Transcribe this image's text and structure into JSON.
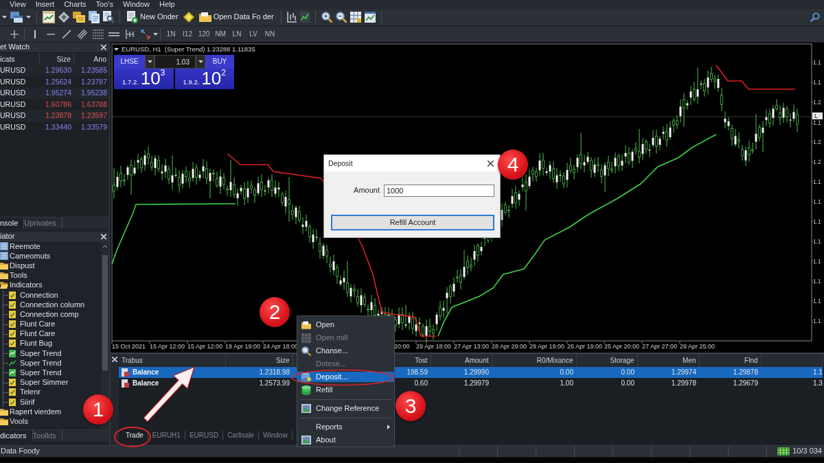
{
  "menu_bar": [
    "View",
    "Insert",
    "Charts",
    "Too's",
    "Window",
    "Help"
  ],
  "toolbar": {
    "new_order": "New Onder",
    "open_data_folder": "Open Data Fo der"
  },
  "timeframes": [
    "1N",
    "I12",
    "120",
    "NM",
    "LN",
    "LV",
    "NN"
  ],
  "market_watch": {
    "title": "et Watch",
    "columns": [
      "icats",
      "Size",
      "Ano"
    ],
    "rows": [
      {
        "symbol": "URUSD",
        "bid": "1.29630",
        "ask": "1.23585",
        "color": "#8585f0"
      },
      {
        "symbol": "URUSD",
        "bid": "1.25624",
        "ask": "1.23787",
        "color": "#8585f0"
      },
      {
        "symbol": "URUSD",
        "bid": "1.95274",
        "ask": "1.95238",
        "color": "#8585f0"
      },
      {
        "symbol": "URUSD",
        "bid": "1.60786",
        "ask": "1.63788",
        "color": "#e0524c"
      },
      {
        "symbol": "URUSD",
        "bid": "1.23878",
        "ask": "1.23597",
        "color": "#e0524c"
      },
      {
        "symbol": "URUSD",
        "bid": "1.33440",
        "ask": "1.33579",
        "color": "#8585f0"
      }
    ]
  },
  "left_tabs": [
    {
      "label": "nsole",
      "selected": true
    },
    {
      "label": "Uprivates",
      "selected": false
    }
  ],
  "navigator": {
    "title": "iator",
    "items": [
      {
        "label": "Reemote",
        "kind": "list"
      },
      {
        "label": "Cameomuts",
        "kind": "list"
      },
      {
        "label": "Dispust",
        "kind": "folder",
        "expanded": false
      },
      {
        "label": "Tools",
        "kind": "folder",
        "expanded": false
      },
      {
        "label": "Indicators",
        "kind": "folder",
        "expanded": true,
        "children": [
          {
            "label": "Connection",
            "kind": "indicator"
          },
          {
            "label": "Connection column",
            "kind": "indicator"
          },
          {
            "label": "Connection comp",
            "kind": "indicator"
          },
          {
            "label": "Flunt Care",
            "kind": "indicator"
          },
          {
            "label": "Flunt Care",
            "kind": "indicator"
          },
          {
            "label": "Flunt Bug",
            "kind": "indicator"
          },
          {
            "label": "Super Trend",
            "kind": "trend"
          },
          {
            "label": "Super Trend",
            "kind": "line"
          },
          {
            "label": "Super Trend",
            "kind": "trend"
          },
          {
            "label": "Super Simmer",
            "kind": "indicator"
          },
          {
            "label": "Telenr",
            "kind": "indicator"
          },
          {
            "label": "Siirif",
            "kind": "indicator"
          }
        ]
      },
      {
        "label": "Rapert vierdem",
        "kind": "folder",
        "expanded": false
      },
      {
        "label": "Vools",
        "kind": "folder",
        "expanded": false
      }
    ]
  },
  "navigator_tabs": [
    {
      "label": "dicators",
      "selected": true
    },
    {
      "label": "Toolkts",
      "selected": false
    }
  ],
  "chart": {
    "title": "EURUSD, H1  (Super Trend) 1.23288 1.11835",
    "trade_panel": {
      "sell": "LHSE",
      "volume": "1.03",
      "buy": "BUY",
      "sell_price": {
        "prefix": "1.7.2.",
        "value": "10$^{3}$"
      },
      "buy_price": {
        "prefix": "1.9.2.",
        "value": "10$^{2}$"
      }
    },
    "price_labels": [
      "1.1",
      "1.1",
      "1.2",
      "1.1",
      "1.2",
      "1.2",
      "1.1",
      "1.1",
      "1.1",
      "1.1",
      "1.1",
      "1.1",
      "1.1",
      "1.1"
    ],
    "current_price_label": "L",
    "time_labels": [
      "15 Oct 2021",
      "15 Apr 12:00",
      "15 Apr 12:00",
      "19 Apr 19:00",
      "24 Apr 18:00",
      "20:00",
      "29 Apr 18:00",
      "27 Apr 13:00",
      "28 Apr 29:00",
      "29 Apr 19:00",
      "26 Apr 19:00",
      "25 Apr 20:00",
      "27 Apr 27:00",
      "29 Apr 25:00"
    ]
  },
  "deposit_dialog": {
    "title": "Deposit",
    "amount_label": "Amount",
    "amount_value": "1000",
    "button": "Refill Account"
  },
  "context_menu": [
    {
      "kind": "item",
      "label": "Open",
      "disabled": false,
      "selected": false
    },
    {
      "kind": "item",
      "label": "Open mill",
      "disabled": true,
      "selected": false
    },
    {
      "kind": "item",
      "label": "Chanse...",
      "disabled": false,
      "selected": false
    },
    {
      "kind": "item",
      "label": "Dotese...",
      "disabled": true,
      "selected": false
    },
    {
      "kind": "item",
      "label": "Deposit...",
      "disabled": false,
      "selected": true
    },
    {
      "kind": "item",
      "label": "Refill",
      "disabled": false,
      "selected": false
    },
    {
      "kind": "separator"
    },
    {
      "kind": "item",
      "label": "Change Reference",
      "disabled": false,
      "selected": false
    },
    {
      "kind": "separator"
    },
    {
      "kind": "item",
      "label": "Reports",
      "disabled": false,
      "selected": false,
      "submenu": true
    },
    {
      "kind": "item",
      "label": "About",
      "disabled": false,
      "selected": false
    }
  ],
  "terminal": {
    "columns": [
      "Trabus",
      "Size",
      "Tost",
      "Amount",
      "R0/Mixance",
      "Storage",
      "Men",
      "Flnd"
    ],
    "rows": [
      {
        "selected": true,
        "cells": [
          "Balance",
          "1.2318.98",
          "198.59",
          "1.29990",
          "0.00",
          "0.00",
          "1.29974",
          "1.29878"
        ],
        "column_10": "1.1"
      },
      {
        "selected": false,
        "cells": [
          "Balance",
          "1.2573.99",
          "0.60",
          "1.29979",
          "1.00",
          "0.00",
          "1.29978",
          "1.29679"
        ],
        "column_10": "1.3"
      }
    ],
    "tabs": [
      {
        "label": "Trade",
        "selected": true
      },
      {
        "label": "EURUH1",
        "selected": false
      },
      {
        "label": "EURUSD",
        "selected": false
      },
      {
        "label": "Carlisale",
        "selected": false
      },
      {
        "label": "Window",
        "selected": false
      }
    ]
  },
  "status_bar": {
    "left": "Data Foody",
    "right": "10/3 034"
  },
  "callouts": [
    "1",
    "2",
    "3",
    "4"
  ]
}
